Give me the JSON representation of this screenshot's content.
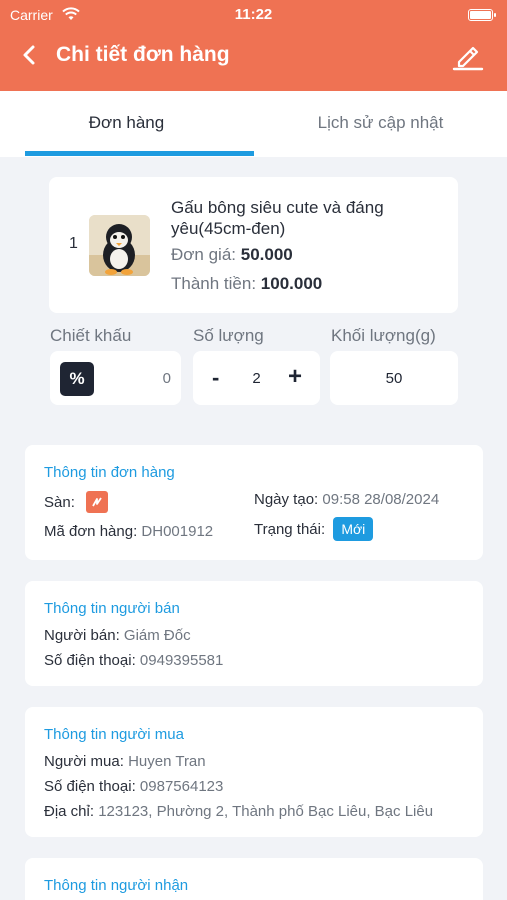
{
  "status_bar": {
    "carrier": "Carrier",
    "time": "11:22"
  },
  "header": {
    "title": "Chi tiết đơn hàng",
    "back_icon": "chevron-left-icon",
    "edit_icon": "pencil-icon"
  },
  "tabs": [
    {
      "label": "Đơn hàng",
      "active": true
    },
    {
      "label": "Lịch sử cập nhật",
      "active": false
    }
  ],
  "product": {
    "index": "1",
    "name": "Gấu bông siêu cute và đáng yêu(45cm-đen)",
    "unit_price_label": "Đơn giá:",
    "unit_price": "50.000",
    "total_label": "Thành tiền:",
    "total": "100.000"
  },
  "fields": {
    "discount_label": "Chiết khấu",
    "discount_symbol": "%",
    "discount_value": "0",
    "quantity_label": "Số lượng",
    "quantity_minus": "-",
    "quantity_value": "2",
    "quantity_plus": "+",
    "weight_label": "Khối lượng(g)",
    "weight_value": "50"
  },
  "order_info": {
    "title": "Thông tin đơn hàng",
    "shop_label": "Sàn:",
    "shop_icon": "shopee-icon",
    "created_label": "Ngày tạo:",
    "created_value": "09:58 28/08/2024",
    "code_label": "Mã đơn hàng:",
    "code_value": "DH001912",
    "status_label": "Trạng thái:",
    "status_value": "Mới"
  },
  "seller_info": {
    "title": "Thông tin người bán",
    "seller_label": "Người bán:",
    "seller_value": "Giám Đốc",
    "phone_label": "Số điện thoại:",
    "phone_value": "0949395581"
  },
  "buyer_info": {
    "title": "Thông tin người mua",
    "buyer_label": "Người mua:",
    "buyer_value": "Huyen Tran",
    "phone_label": "Số điện thoại:",
    "phone_value": "0987564123",
    "address_label": "Địa chỉ:",
    "address_value": "123123, Phường 2, Thành phố Bạc Liêu, Bạc Liêu"
  },
  "receiver_info": {
    "title": "Thông tin người nhận"
  },
  "colors": {
    "header": "#ef7253",
    "accent": "#1e9be0",
    "background": "#f1f3f7"
  }
}
